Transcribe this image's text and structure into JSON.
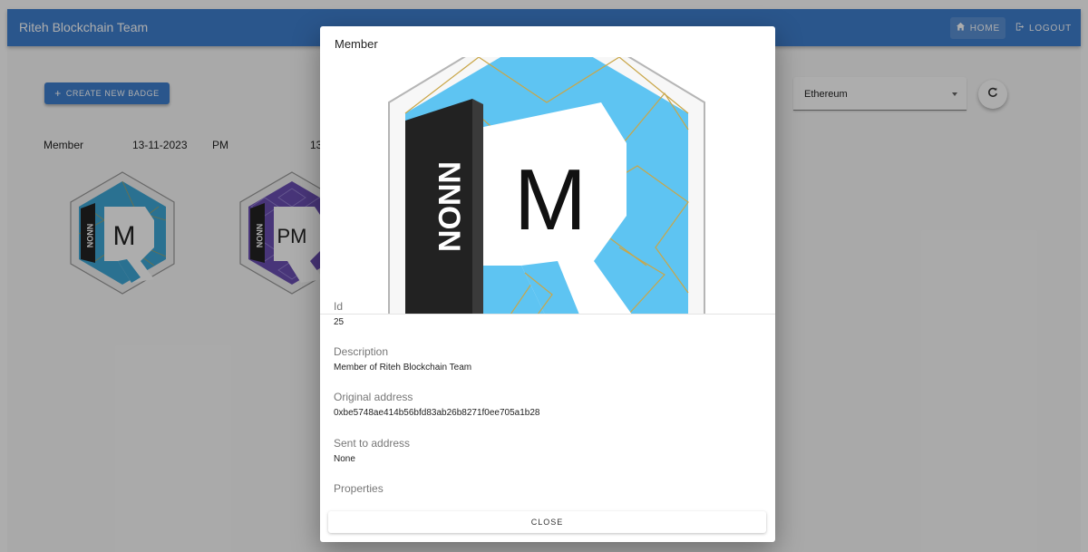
{
  "appbar": {
    "title": "Riteh Blockchain Team",
    "home_label": "HOME",
    "logout_label": "LOGOUT",
    "home_icon": "home-icon",
    "logout_icon": "logout-icon"
  },
  "toolbar": {
    "create_label": "CREATE NEW BADGE",
    "create_icon": "plus-icon"
  },
  "chain_select": {
    "value": "Ethereum",
    "refresh_icon": "refresh-icon"
  },
  "badge_list": {
    "items": [
      {
        "name": "Member",
        "date": "13-11-2023",
        "letter": "M"
      },
      {
        "name": "PM",
        "date": "13",
        "letter": "PM"
      }
    ]
  },
  "dialog": {
    "title": "Member",
    "badge_letter": "M",
    "badge_side_text": "NNON",
    "fields": [
      {
        "label": "Id",
        "value": "25"
      },
      {
        "label": "Description",
        "value": "Member of Riteh Blockchain Team"
      },
      {
        "label": "Original address",
        "value": "0xbe5748ae414b56bfd83ab26b8271f0ee705a1b28"
      },
      {
        "label": "Sent to address",
        "value": "None"
      },
      {
        "label": "Properties",
        "value": ""
      }
    ],
    "close_label": "CLOSE"
  },
  "colors": {
    "primary": "#3f7fcf",
    "badge_member_sky": "#5ec4f2",
    "badge_pm_purple": "#6a4fb3",
    "gold_line": "#c9a648"
  }
}
